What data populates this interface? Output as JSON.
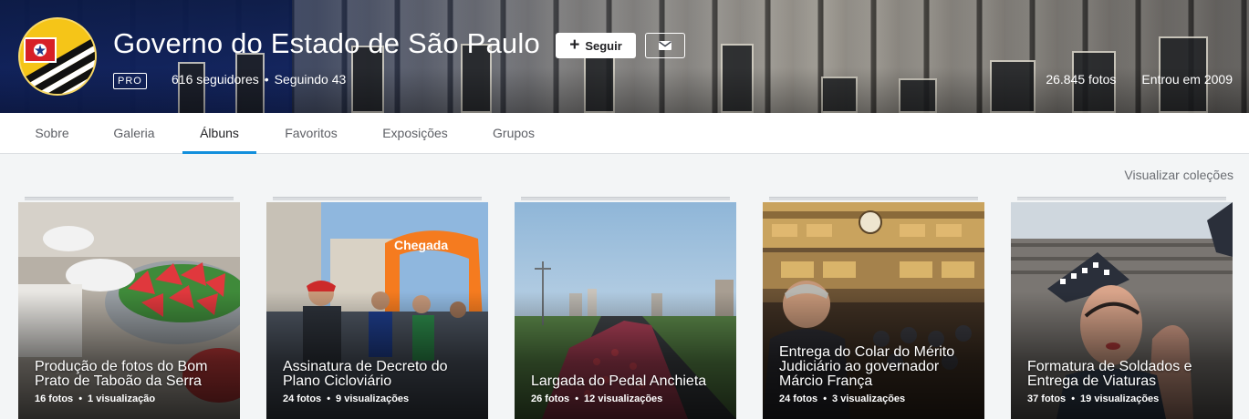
{
  "profile": {
    "name": "Governo do Estado de São Paulo",
    "badge": "PRO",
    "followers": "616 seguidores",
    "following": "Seguindo 43",
    "photos": "26.845 fotos",
    "joined": "Entrou em 2009",
    "follow_label": "Seguir",
    "separator": "•"
  },
  "tabs": [
    {
      "label": "Sobre",
      "active": false
    },
    {
      "label": "Galeria",
      "active": false
    },
    {
      "label": "Álbuns",
      "active": true
    },
    {
      "label": "Favoritos",
      "active": false
    },
    {
      "label": "Exposições",
      "active": false
    },
    {
      "label": "Grupos",
      "active": false
    }
  ],
  "view_collections": "Visualizar coleções",
  "albums": [
    {
      "title": "Produção de fotos do Bom Prato de Taboão da Serra",
      "photos": "16 fotos",
      "views": "1 visualização"
    },
    {
      "title": "Assinatura de Decreto do Plano Cicloviário",
      "photos": "24 fotos",
      "views": "9 visualizações"
    },
    {
      "title": "Largada do Pedal Anchieta",
      "photos": "26 fotos",
      "views": "12 visualizações"
    },
    {
      "title": "Entrega do Colar do Mérito Judiciário ao governador Márcio França",
      "photos": "24 fotos",
      "views": "3 visualizações"
    },
    {
      "title": "Formatura de Soldados e Entrega de Viaturas",
      "photos": "37 fotos",
      "views": "19 visualizações"
    }
  ],
  "photo_texts": {
    "chegada_sign": "Chegada"
  },
  "colors": {
    "accent": "#128fdc",
    "header_blue": "#12266b",
    "flag_red": "#d72027",
    "flag_yellow": "#f5c518"
  },
  "icons": {
    "avatar": "sao-paulo-flag-logo",
    "follow": "plus-icon",
    "message": "mail-icon"
  }
}
